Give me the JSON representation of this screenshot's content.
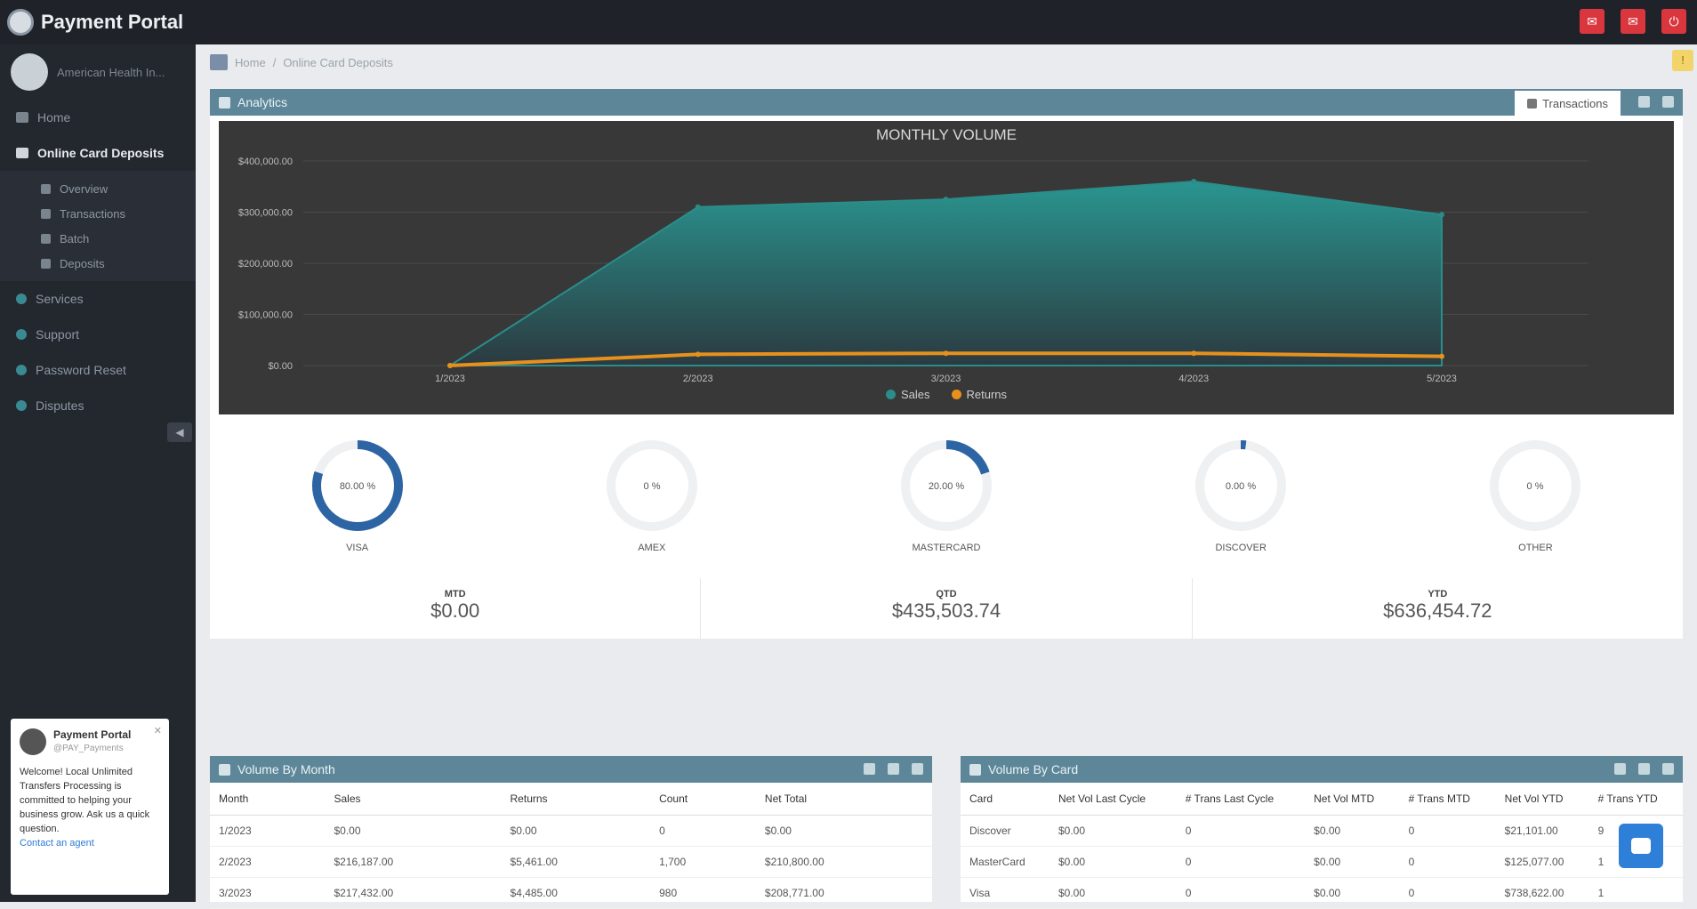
{
  "app": {
    "title": "Payment Portal"
  },
  "topbar": {
    "icons": [
      "notification-icon",
      "mail-icon",
      "power-icon"
    ]
  },
  "sidebar": {
    "user_name": "American Health In...",
    "items": [
      {
        "label": "Home",
        "icon": "home-icon"
      },
      {
        "label": "Online Card Deposits",
        "icon": "card-icon",
        "active": true
      }
    ],
    "subitems": [
      {
        "label": "Overview",
        "icon": "dashboard-icon"
      },
      {
        "label": "Transactions",
        "icon": "list-icon"
      },
      {
        "label": "Batch",
        "icon": "batch-icon"
      },
      {
        "label": "Deposits",
        "icon": "dollar-icon"
      }
    ],
    "more_items": [
      {
        "label": "Services"
      },
      {
        "label": "Support"
      },
      {
        "label": "Password Reset"
      },
      {
        "label": "Disputes"
      }
    ]
  },
  "chat_card": {
    "title": "Payment Portal",
    "subtitle": "@PAY_Payments",
    "text": "Welcome! Local Unlimited Transfers Processing is committed to helping your business grow. Ask us a quick question.",
    "link": "Contact an agent"
  },
  "breadcrumb": [
    "Home",
    "Online Card Deposits"
  ],
  "analytics_panel": {
    "title": "Analytics",
    "tab_label": "Transactions"
  },
  "chart_data": {
    "type": "area",
    "title": "MONTHLY VOLUME",
    "x": [
      "1/2023",
      "2/2023",
      "3/2023",
      "4/2023",
      "5/2023"
    ],
    "yticks": [
      "$400,000.00",
      "$300,000.00",
      "$200,000.00",
      "$100,000.00",
      "$0.00"
    ],
    "ylim": [
      0,
      400000
    ],
    "series": [
      {
        "name": "Sales",
        "color": "#2a8d8a",
        "values": [
          0,
          310000,
          325000,
          360000,
          295000
        ]
      },
      {
        "name": "Returns",
        "color": "#e8901c",
        "values": [
          0,
          22000,
          24000,
          24000,
          18000
        ]
      }
    ],
    "legend": "bottom-center",
    "grid": true
  },
  "donuts": [
    {
      "label": "VISA",
      "value": "80.00 %",
      "fraction": 0.8,
      "color": "#2d64a3"
    },
    {
      "label": "AMEX",
      "value": "0 %",
      "fraction": 0,
      "color": "#2d64a3"
    },
    {
      "label": "MASTERCARD",
      "value": "20.00 %",
      "fraction": 0.2,
      "color": "#2d64a3"
    },
    {
      "label": "DISCOVER",
      "value": "0.00 %",
      "fraction": 0.02,
      "color": "#2d64a3"
    },
    {
      "label": "OTHER",
      "value": "0 %",
      "fraction": 0,
      "color": "#2d64a3"
    }
  ],
  "totals": [
    {
      "label": "MTD",
      "value": "$0.00"
    },
    {
      "label": "QTD",
      "value": "$435,503.74"
    },
    {
      "label": "YTD",
      "value": "$636,454.72"
    }
  ],
  "volume_by_month": {
    "title": "Volume By Month",
    "columns": [
      "Month",
      "Sales",
      "Returns",
      "Count",
      "Net Total"
    ],
    "rows": [
      [
        "1/2023",
        "$0.00",
        "$0.00",
        "0",
        "$0.00"
      ],
      [
        "2/2023",
        "$216,187.00",
        "$5,461.00",
        "1,700",
        "$210,800.00"
      ],
      [
        "3/2023",
        "$217,432.00",
        "$4,485.00",
        "980",
        "$208,771.00"
      ]
    ]
  },
  "volume_by_card": {
    "title": "Volume By Card",
    "columns": [
      "Card",
      "Net Vol Last Cycle",
      "# Trans Last Cycle",
      "Net Vol MTD",
      "# Trans MTD",
      "Net Vol YTD",
      "# Trans YTD"
    ],
    "rows": [
      [
        "Discover",
        "$0.00",
        "0",
        "$0.00",
        "0",
        "$21,101.00",
        "9"
      ],
      [
        "MasterCard",
        "$0.00",
        "0",
        "$0.00",
        "0",
        "$125,077.00",
        "1"
      ],
      [
        "Visa",
        "$0.00",
        "0",
        "$0.00",
        "0",
        "$738,622.00",
        "1"
      ]
    ]
  }
}
